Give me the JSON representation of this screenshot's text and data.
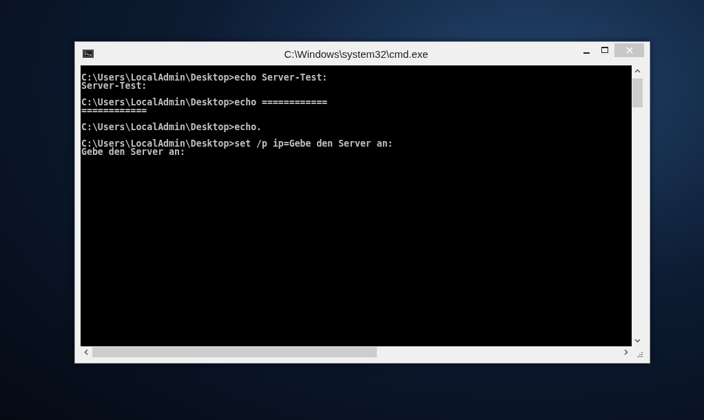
{
  "window": {
    "title": "C:\\Windows\\system32\\cmd.exe"
  },
  "console": {
    "blocks": [
      {
        "lines": [
          "C:\\Users\\LocalAdmin\\Desktop>echo Server-Test:",
          "Server-Test:"
        ]
      },
      {
        "lines": [
          "C:\\Users\\LocalAdmin\\Desktop>echo ============",
          "============"
        ]
      },
      {
        "lines": [
          "C:\\Users\\LocalAdmin\\Desktop>echo."
        ]
      },
      {
        "lines": [
          "C:\\Users\\LocalAdmin\\Desktop>set /p ip=Gebe den Server an:",
          "Gebe den Server an:"
        ]
      }
    ]
  }
}
